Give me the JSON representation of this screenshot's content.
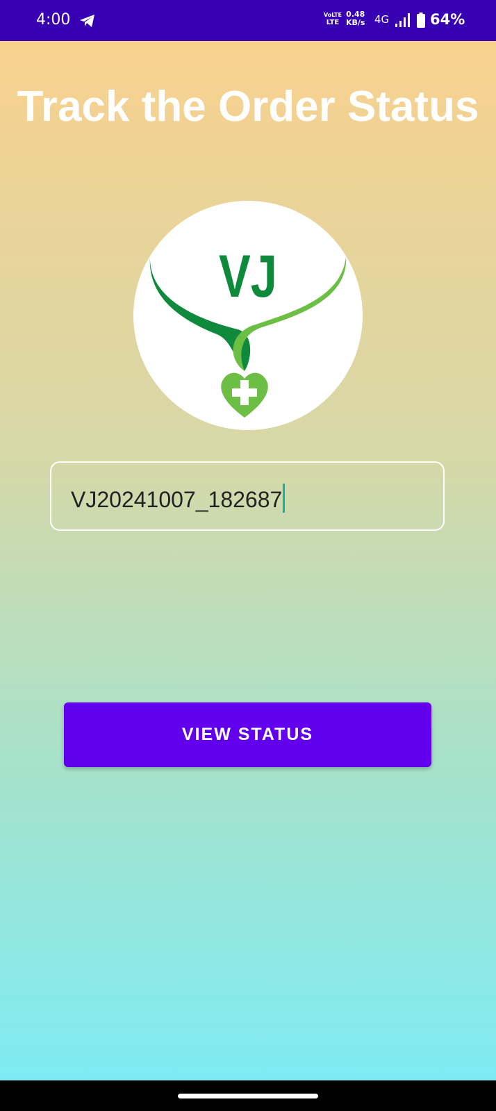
{
  "status_bar": {
    "time": "4:00",
    "volte_top": "VoLTE",
    "volte_bottom": "LTE",
    "speed_value": "0.48",
    "speed_unit": "KB/s",
    "network": "4G",
    "battery": "64%"
  },
  "page": {
    "title": "Track the Order Status",
    "logo_text": "VJ"
  },
  "order_input": {
    "value": "VJ20241007_182687"
  },
  "view_status_button": {
    "label": "VIEW STATUS"
  },
  "colors": {
    "status_bar": "#3700b3",
    "button": "#6200ee",
    "logo_green_dark": "#0f8a3c",
    "logo_green_light": "#6cbe45"
  }
}
